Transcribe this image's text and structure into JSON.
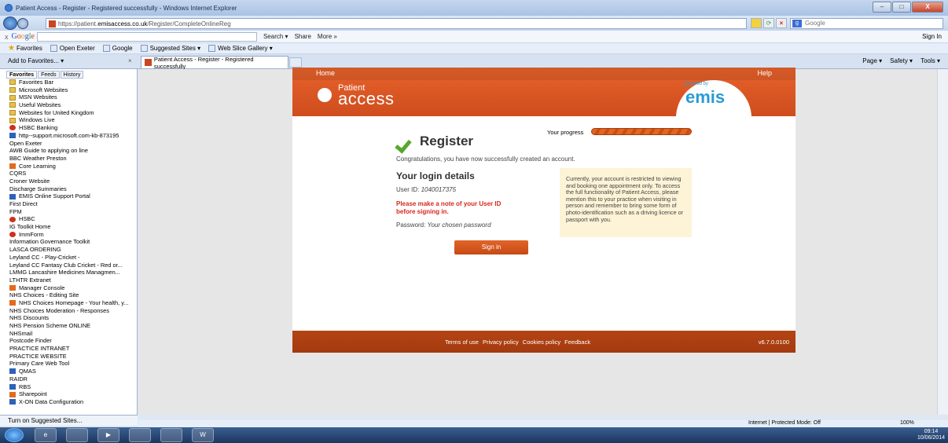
{
  "window": {
    "title": "Patient Access - Register - Registered successfully - Windows Internet Explorer",
    "min": "–",
    "max": "□",
    "close": "X"
  },
  "address": {
    "url_prefix": "https://patient.",
    "url_host": "emisaccess.co.uk",
    "url_path": "/Register/CompleteOnlineReg",
    "search_placeholder": "Google"
  },
  "google_toolbar": {
    "close": "x",
    "search_label": "Search ▾",
    "share_label": "Share",
    "more_label": "More »",
    "sign_in": "Sign In"
  },
  "favorites_bar": {
    "favorites": "Favorites",
    "items": [
      "Open Exeter",
      "Google",
      "Suggested Sites ▾",
      "Web Slice Gallery ▾"
    ]
  },
  "tabs": {
    "add_favorites": "Add to Favorites... ▾",
    "close_x": "×",
    "active_tab": "Patient Access - Register - Registered successfully",
    "commands": [
      "Page ▾",
      "Safety ▾",
      "Tools ▾"
    ]
  },
  "fav_panel": {
    "tabs": [
      "Favorites",
      "Feeds",
      "History"
    ],
    "items": [
      {
        "label": "Favorites Bar",
        "icon": "folder"
      },
      {
        "label": "Microsoft Websites",
        "icon": "folder"
      },
      {
        "label": "MSN Websites",
        "icon": "folder"
      },
      {
        "label": "Useful Websites",
        "icon": "folder"
      },
      {
        "label": "Websites for United Kingdom",
        "icon": "folder"
      },
      {
        "label": "Windows Live",
        "icon": "folder"
      },
      {
        "label": "HSBC Banking",
        "icon": "red"
      },
      {
        "label": "http--support.microsoft.com-kb-873195",
        "icon": "blue"
      },
      {
        "label": "Open Exeter",
        "icon": "page"
      },
      {
        "label": "AWB Guide to applying on line",
        "icon": "page"
      },
      {
        "label": "BBC Weather Preston",
        "icon": "page"
      },
      {
        "label": "Core Learning",
        "icon": "orange"
      },
      {
        "label": "CQRS",
        "icon": "page"
      },
      {
        "label": "Croner Website",
        "icon": "page"
      },
      {
        "label": "Discharge Summaries",
        "icon": "page"
      },
      {
        "label": "EMIS Online Support Portal",
        "icon": "blue"
      },
      {
        "label": "First Direct",
        "icon": "page"
      },
      {
        "label": "FPM",
        "icon": "page"
      },
      {
        "label": "HSBC",
        "icon": "red"
      },
      {
        "label": "IG Toolkit Home",
        "icon": "page"
      },
      {
        "label": "ImmForm",
        "icon": "red"
      },
      {
        "label": "Information Governance Toolkit",
        "icon": "page"
      },
      {
        "label": "LASCA ORDERING",
        "icon": "page"
      },
      {
        "label": "Leyland CC - Play-Cricket -",
        "icon": "page"
      },
      {
        "label": "Leyland CC Fantasy Club Cricket - Red or...",
        "icon": "page"
      },
      {
        "label": "LMMG Lancashire Medicines Managmen...",
        "icon": "page"
      },
      {
        "label": "LTHTR Extranet",
        "icon": "page"
      },
      {
        "label": "Manager Console",
        "icon": "orange"
      },
      {
        "label": "NHS Choices - Editing Site",
        "icon": "page"
      },
      {
        "label": "NHS Choices Homepage - Your health, y...",
        "icon": "orange"
      },
      {
        "label": "NHS Choices Moderation - Responses",
        "icon": "page"
      },
      {
        "label": "NHS Discounts",
        "icon": "page"
      },
      {
        "label": "NHS Pension Scheme ONLINE",
        "icon": "page"
      },
      {
        "label": "NHSmail",
        "icon": "page"
      },
      {
        "label": "Postcode Finder",
        "icon": "page"
      },
      {
        "label": "PRACTICE INTRANET",
        "icon": "page"
      },
      {
        "label": "PRACTICE WEBSITE",
        "icon": "page"
      },
      {
        "label": "Primary Care Web Tool",
        "icon": "page"
      },
      {
        "label": "QMAS",
        "icon": "blue"
      },
      {
        "label": "RAIDR",
        "icon": "page"
      },
      {
        "label": "RBS",
        "icon": "blue"
      },
      {
        "label": "Sharepoint",
        "icon": "orange"
      },
      {
        "label": "X-ON Data Configuration",
        "icon": "blue"
      }
    ],
    "turn_on": "Turn on Suggested Sites..."
  },
  "site": {
    "nav_home": "Home",
    "nav_help": "Help",
    "brand_small": "Patient",
    "brand_big": "access",
    "powered_by": "powered by",
    "emis": "emis",
    "progress_label": "Your progress",
    "progress": 1.0,
    "heading": "Register",
    "congrats": "Congratulations, you have now successfully created an account.",
    "login_heading": "Your login details",
    "user_id_label": "User ID:",
    "user_id_value": "1040017375",
    "note": "Please make a note of your User ID before signing in.",
    "password_label": "Password:",
    "password_value": "Your chosen password",
    "info": "Currently, your account is restricted to viewing and booking one appointment only. To access the full functionality of Patient Access, please mention this to your practice when visiting in person and remember to bring some form of photo-identification such as a driving licence or passport with you.",
    "sign_in": "Sign in",
    "footer_links": [
      "Terms of use",
      "Privacy policy",
      "Cookies policy",
      "Feedback"
    ],
    "version": "v6.7.0.0100"
  },
  "status": {
    "zone": "Internet | Protected Mode: Off",
    "zoom": "100%"
  },
  "taskbar": {
    "clock_time": "09:14",
    "clock_date": "10/06/2014"
  }
}
